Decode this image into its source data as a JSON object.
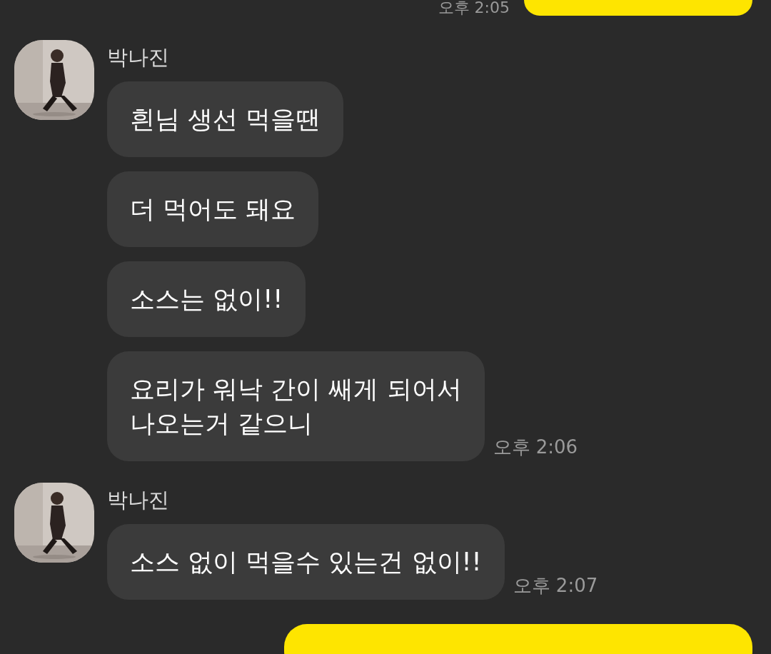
{
  "top": {
    "time": "오후 2:05"
  },
  "groups": [
    {
      "sender": "박나진",
      "avatar": {
        "kind": "picture"
      },
      "messages": [
        "흰님 생선 먹을땐",
        "더 먹어도 돼요",
        "소스는 없이!!",
        "요리가 워낙 간이 쌔게 되어서\n나오는거 같으니"
      ],
      "time": "오후 2:06"
    },
    {
      "sender": "박나진",
      "avatar": {
        "kind": "picture"
      },
      "messages": [
        "소스 없이 먹을수 있는건 없이!!"
      ],
      "time": "오후 2:07"
    }
  ]
}
